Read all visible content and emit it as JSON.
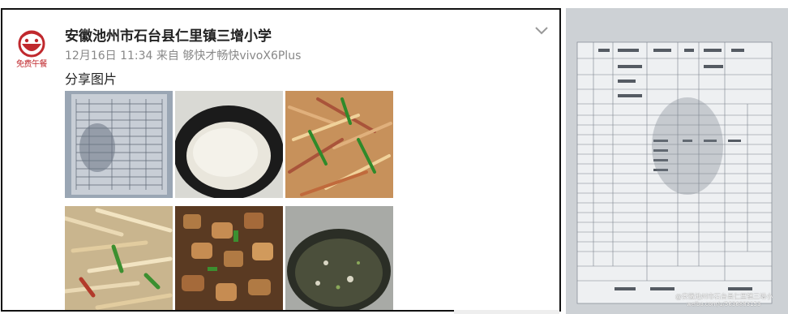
{
  "post": {
    "account_name": "安徽池州市石台县仁里镇三增小学",
    "timestamp": "12月16日 11:34",
    "source_prefix": "来自",
    "source_device": "够快才畅快vivoX6Plus",
    "text": "分享图片",
    "avatar_label": "免费午餐"
  },
  "icons": {
    "more": "chevron-down-icon",
    "avatar": "free-lunch-logo-icon"
  },
  "thumbnails": [
    {
      "id": "meal-record-sheet",
      "label": "表格照片"
    },
    {
      "id": "steamed-rice-pot",
      "label": "米饭"
    },
    {
      "id": "stir-fried-potato-strips",
      "label": "炒菜"
    },
    {
      "id": "shredded-tofu-dish",
      "label": "炒菜"
    },
    {
      "id": "braised-meat-dish",
      "label": "炒肉"
    },
    {
      "id": "soup-pot",
      "label": "汤"
    }
  ],
  "large_photo": {
    "watermark": "@安徽池州市石台县仁里镇三增小",
    "watermark_sub": "weibo.com/u/5636883153"
  },
  "colors": {
    "brand_red": "#c0282d",
    "meta_gray": "#888888"
  }
}
